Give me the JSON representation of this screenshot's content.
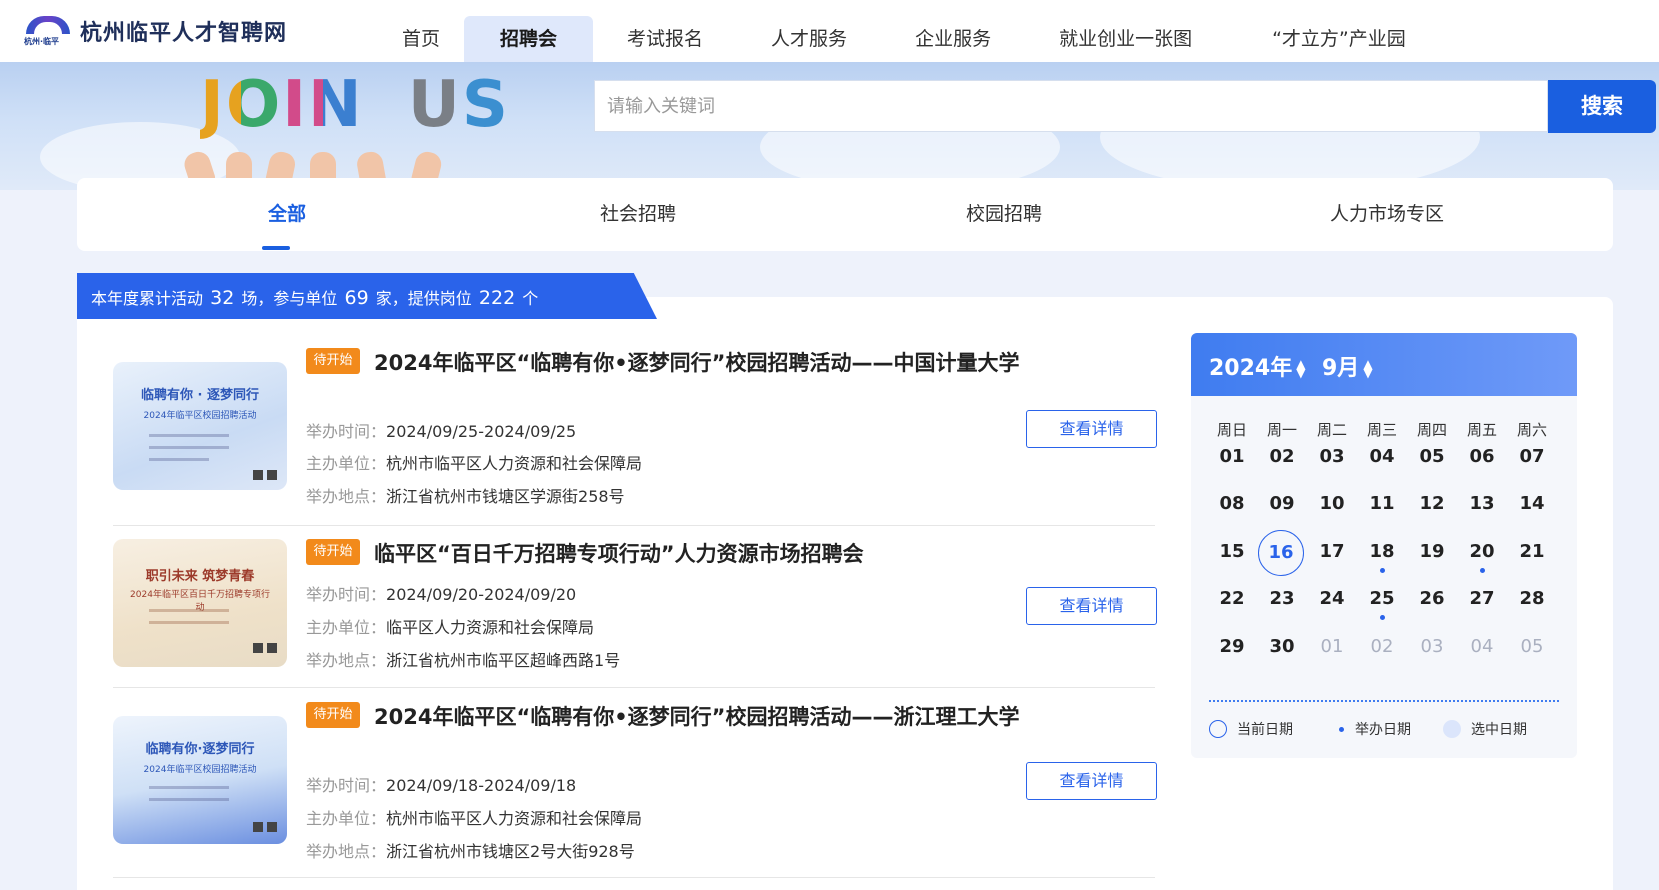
{
  "header": {
    "logo_text": "杭州临平人才智聘网",
    "logo_sub": "杭州·临平",
    "nav": [
      {
        "label": "首页",
        "active": false
      },
      {
        "label": "招聘会",
        "active": true
      },
      {
        "label": "考试报名",
        "active": false
      },
      {
        "label": "人才服务",
        "active": false
      },
      {
        "label": "企业服务",
        "active": false
      },
      {
        "label": "就业创业一张图",
        "active": false
      },
      {
        "label": "“才立方”产业园",
        "active": false
      }
    ]
  },
  "banner": {
    "join_text": "JOIN",
    "us_text": "US",
    "search_placeholder": "请输入关键词",
    "search_button": "搜索"
  },
  "tabs": [
    {
      "label": "全部",
      "active": true
    },
    {
      "label": "社会招聘",
      "active": false
    },
    {
      "label": "校园招聘",
      "active": false
    },
    {
      "label": "人力市场专区",
      "active": false
    }
  ],
  "stats": {
    "prefix": "本年度累计活动",
    "activities": "32",
    "unit1": "场，参与单位",
    "companies": "69",
    "unit2": "家，提供岗位",
    "positions": "222",
    "unit3": "个"
  },
  "labels": {
    "time": "举办时间：",
    "host": "主办单位：",
    "place": "举办地点：",
    "detail": "查看详情"
  },
  "events": [
    {
      "badge": "待开始",
      "title": "2024年临平区“临聘有你•逐梦同行”校园招聘活动——中国计量大学",
      "time": "2024/09/25-2024/09/25",
      "host": "杭州市临平区人力资源和社会保障局",
      "place": "浙江省杭州市钱塘区学源街258号",
      "thumb_title": "临聘有你 · 逐梦同行",
      "thumb_sub": "2024年临平区校园招聘活动"
    },
    {
      "badge": "待开始",
      "title": "临平区“百日千万招聘专项行动”人力资源市场招聘会",
      "time": "2024/09/20-2024/09/20",
      "host": "临平区人力资源和社会保障局",
      "place": "浙江省杭州市临平区超峰西路1号",
      "thumb_title": "职引未来 筑梦青春",
      "thumb_sub": "2024年临平区百日千万招聘专项行动"
    },
    {
      "badge": "待开始",
      "title": "2024年临平区“临聘有你•逐梦同行”校园招聘活动——浙江理工大学",
      "time": "2024/09/18-2024/09/18",
      "host": "杭州市临平区人力资源和社会保障局",
      "place": "浙江省杭州市钱塘区2号大街928号",
      "thumb_title": "临聘有你·逐梦同行",
      "thumb_sub": "2024年临平区校园招聘活动"
    }
  ],
  "calendar": {
    "year": "2024年",
    "month": "9月",
    "weekdays": [
      "周日",
      "周一",
      "周二",
      "周三",
      "周四",
      "周五",
      "周六"
    ],
    "days": [
      [
        "01",
        "02",
        "03",
        "04",
        "05",
        "06",
        "07"
      ],
      [
        "08",
        "09",
        "10",
        "11",
        "12",
        "13",
        "14"
      ],
      [
        "15",
        "16",
        "17",
        "18",
        "19",
        "20",
        "21"
      ],
      [
        "22",
        "23",
        "24",
        "25",
        "26",
        "27",
        "28"
      ],
      [
        "29",
        "30",
        "01",
        "02",
        "03",
        "04",
        "05"
      ]
    ],
    "today": "16",
    "event_days": [
      "18",
      "20",
      "25"
    ],
    "legend": {
      "current": "当前日期",
      "event": "举办日期",
      "selected": "选中日期"
    },
    "colors": {
      "accent": "#2a63ea",
      "header": "#3f7cf0"
    }
  }
}
